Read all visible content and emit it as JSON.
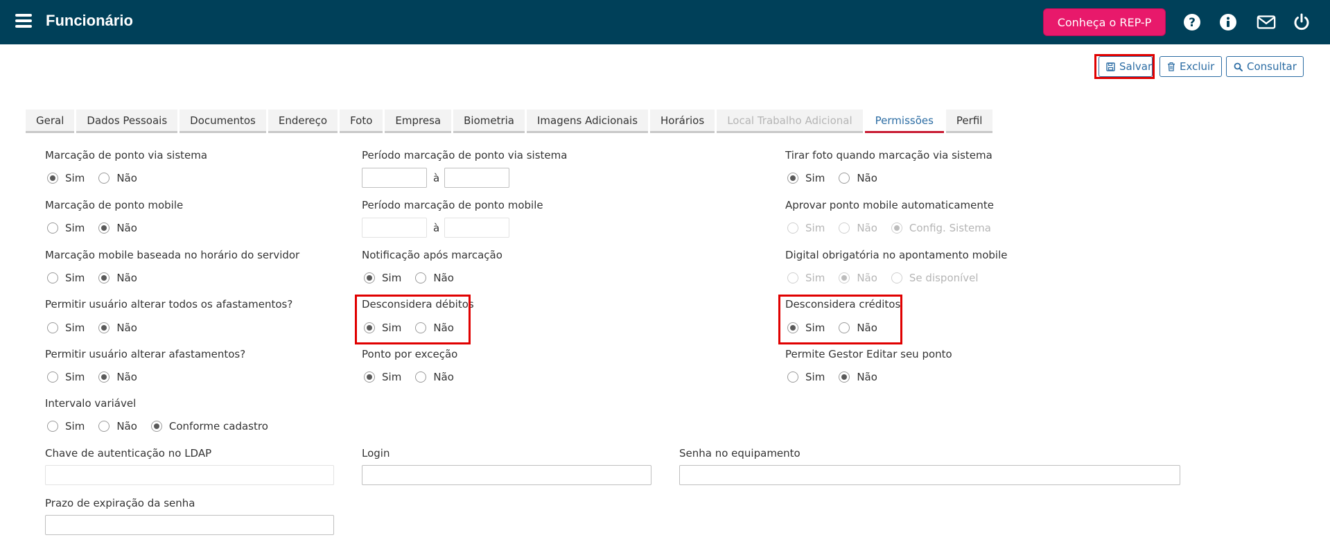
{
  "header": {
    "title": "Funcionário",
    "rep_button": "Conheça o REP-P",
    "icons": [
      "help-icon",
      "info-icon",
      "mail-icon",
      "power-icon"
    ]
  },
  "actions": {
    "save": "Salvar",
    "delete": "Excluir",
    "search": "Consultar"
  },
  "tabs": [
    {
      "label": "Geral"
    },
    {
      "label": "Dados Pessoais"
    },
    {
      "label": "Documentos"
    },
    {
      "label": "Endereço"
    },
    {
      "label": "Foto"
    },
    {
      "label": "Empresa"
    },
    {
      "label": "Biometria"
    },
    {
      "label": "Imagens Adicionais"
    },
    {
      "label": "Horários"
    },
    {
      "label": "Local Trabalho Adicional",
      "disabled": true
    },
    {
      "label": "Permissões",
      "active": true
    },
    {
      "label": "Perfil"
    }
  ],
  "form": {
    "marcacao_sistema": {
      "label": "Marcação de ponto via sistema",
      "options": [
        "Sim",
        "Não"
      ],
      "selected": "Sim"
    },
    "marcacao_mobile": {
      "label": "Marcação de ponto mobile",
      "options": [
        "Sim",
        "Não"
      ],
      "selected": "Não"
    },
    "mobile_servidor": {
      "label": "Marcação mobile baseada no horário do servidor",
      "options": [
        "Sim",
        "Não"
      ],
      "selected": "Não"
    },
    "alterar_todos_afast": {
      "label": "Permitir usuário alterar todos os afastamentos?",
      "options": [
        "Sim",
        "Não"
      ],
      "selected": "Não"
    },
    "alterar_afast": {
      "label": "Permitir usuário alterar afastamentos?",
      "options": [
        "Sim",
        "Não"
      ],
      "selected": "Não"
    },
    "intervalo_variavel": {
      "label": "Intervalo variável",
      "options": [
        "Sim",
        "Não",
        "Conforme cadastro"
      ],
      "selected": "Conforme cadastro"
    },
    "periodo_sistema": {
      "label": "Período marcação de ponto via sistema",
      "separator": "à",
      "from": "",
      "to": ""
    },
    "periodo_mobile": {
      "label": "Período marcação de ponto mobile",
      "separator": "à",
      "from": "",
      "to": ""
    },
    "notificacao": {
      "label": "Notificação após marcação",
      "options": [
        "Sim",
        "Não"
      ],
      "selected": "Sim"
    },
    "desc_debitos": {
      "label": "Desconsidera débitos",
      "options": [
        "Sim",
        "Não"
      ],
      "selected": "Sim"
    },
    "ponto_excecao": {
      "label": "Ponto por exceção",
      "options": [
        "Sim",
        "Não"
      ],
      "selected": "Sim"
    },
    "tirar_foto": {
      "label": "Tirar foto quando marcação via sistema",
      "options": [
        "Sim",
        "Não"
      ],
      "selected": "Sim"
    },
    "aprovar_mobile": {
      "label": "Aprovar ponto mobile automaticamente",
      "options": [
        "Sim",
        "Não",
        "Config. Sistema"
      ],
      "selected": "Config. Sistema",
      "disabled": true
    },
    "digital_obrig": {
      "label": "Digital obrigatória no apontamento mobile",
      "options": [
        "Sim",
        "Não",
        "Se disponível"
      ],
      "selected": "Não",
      "disabled": true
    },
    "desc_creditos": {
      "label": "Desconsidera créditos",
      "options": [
        "Sim",
        "Não"
      ],
      "selected": "Sim"
    },
    "gestor_editar": {
      "label": "Permite Gestor Editar seu ponto",
      "options": [
        "Sim",
        "Não"
      ],
      "selected": "Não"
    },
    "ldap": {
      "label": "Chave de autenticação no LDAP",
      "value": ""
    },
    "login": {
      "label": "Login",
      "value": ""
    },
    "senha_equip": {
      "label": "Senha no equipamento",
      "value": ""
    },
    "prazo_senha": {
      "label": "Prazo de expiração da senha",
      "value": ""
    }
  },
  "colors": {
    "header": "#004059",
    "rep_button": "#e8196b",
    "accent": "#2b6ca3",
    "highlight": "#e00000"
  }
}
